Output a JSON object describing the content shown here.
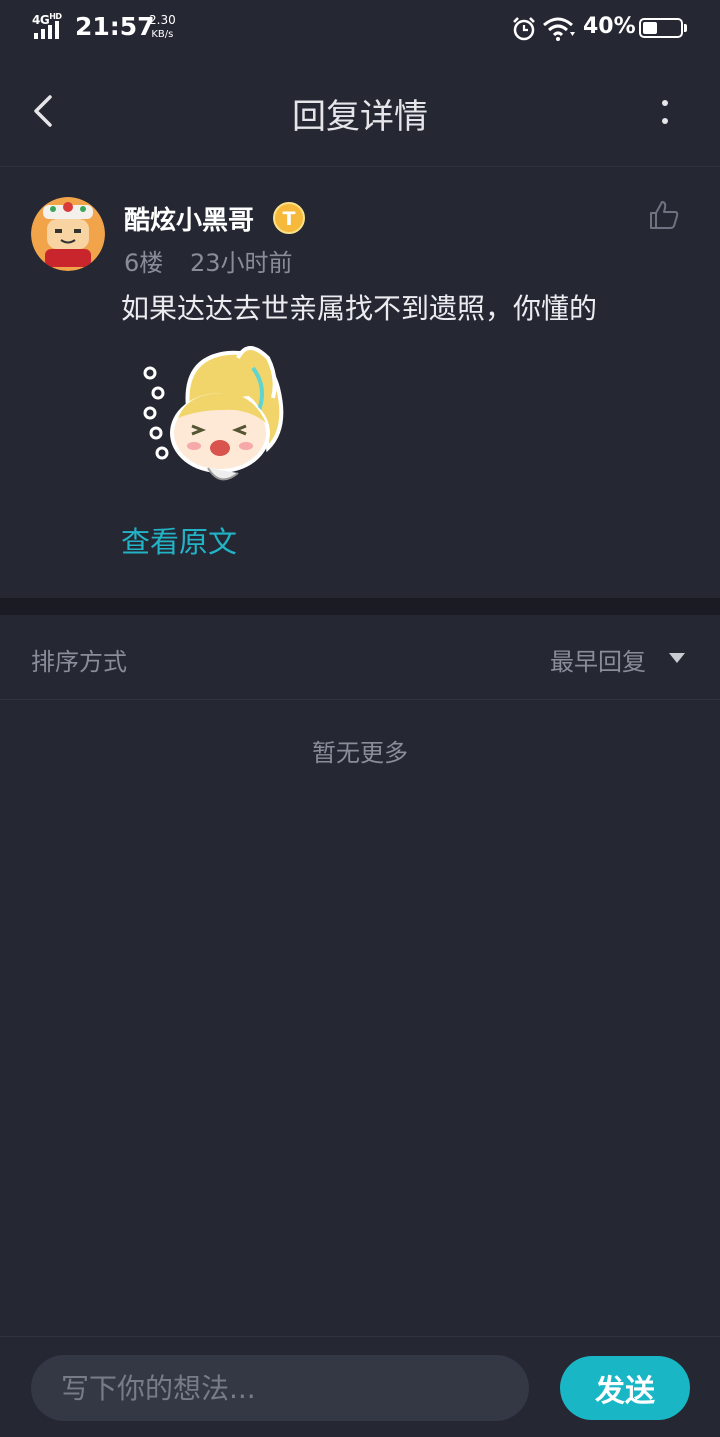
{
  "status_bar": {
    "network": "4G",
    "network_sup": "HD",
    "time": "21:57",
    "speed_value": "2.30",
    "speed_unit": "KB/s",
    "battery_text": "40%",
    "battery_level": 0.4
  },
  "header": {
    "title": "回复详情",
    "back_icon": "chevron-left-icon",
    "more_icon": "more-vertical-icon"
  },
  "post": {
    "username": "酷炫小黑哥",
    "badge_icon": "level-badge-icon",
    "floor": "6楼",
    "time_ago": "23小时前",
    "content": "如果达达去世亲属找不到遗照，你懂的",
    "view_original": "查看原文",
    "like_icon": "thumbs-up-icon"
  },
  "sort": {
    "label": "排序方式",
    "selected": "最早回复"
  },
  "empty_state": "暂无更多",
  "composer": {
    "placeholder": "写下你的想法...",
    "send_label": "发送"
  },
  "colors": {
    "background": "#252733",
    "accent": "#19b6c6",
    "link": "#22b3c6",
    "muted_text": "#8a8d99"
  }
}
